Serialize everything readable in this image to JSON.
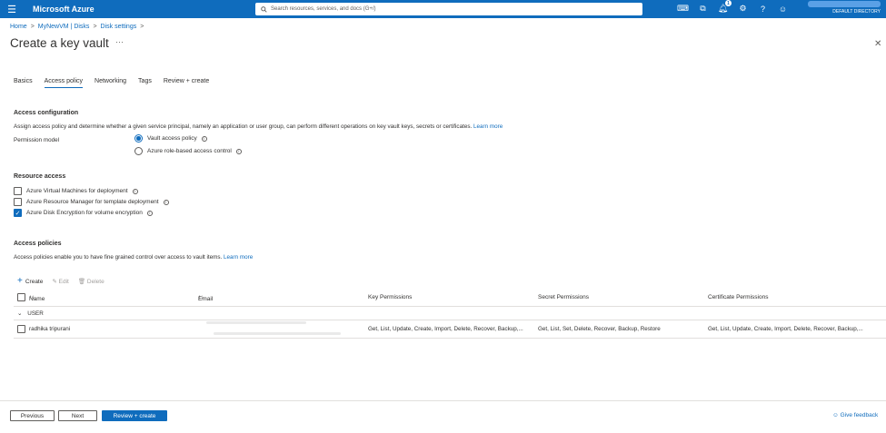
{
  "header": {
    "brand": "Microsoft Azure",
    "search_placeholder": "Search resources, services, and docs (G+/)",
    "notification_count": "1",
    "directory": "DEFAULT DIRECTORY"
  },
  "breadcrumb": [
    "Home",
    "MyNewVM | Disks",
    "Disk settings"
  ],
  "page": {
    "title": "Create a key vault",
    "more": "···",
    "close": "✕"
  },
  "tabs": [
    "Basics",
    "Access policy",
    "Networking",
    "Tags",
    "Review + create"
  ],
  "active_tab": "Access policy",
  "access_config": {
    "heading": "Access configuration",
    "description": "Assign access policy and determine whether a given service principal, namely an application or user group, can perform different operations on key vault keys, secrets or certificates.",
    "learn_more": "Learn more",
    "permission_label": "Permission model",
    "options": [
      "Vault access policy",
      "Azure role-based access control"
    ],
    "selected": "Vault access policy"
  },
  "resource_access": {
    "heading": "Resource access",
    "items": [
      {
        "label": "Azure Virtual Machines for deployment",
        "checked": false
      },
      {
        "label": "Azure Resource Manager for template deployment",
        "checked": false
      },
      {
        "label": "Azure Disk Encryption for volume encryption",
        "checked": true
      }
    ]
  },
  "access_policies": {
    "heading": "Access policies",
    "description": "Access policies enable you to have fine grained control over access to vault items.",
    "learn_more": "Learn more",
    "toolbar": {
      "create": "Create",
      "edit": "Edit",
      "delete": "Delete"
    },
    "columns": [
      "Name",
      "Email",
      "Key Permissions",
      "Secret Permissions",
      "Certificate Permissions"
    ],
    "group": "USER",
    "rows": [
      {
        "name": "radhika tripurani",
        "key": "Get, List, Update, Create, Import, Delete, Recover, Backup,...",
        "secret": "Get, List, Set, Delete, Recover, Backup, Restore",
        "cert": "Get, List, Update, Create, Import, Delete, Recover, Backup,..."
      }
    ]
  },
  "footer": {
    "previous": "Previous",
    "next": "Next",
    "review": "Review + create",
    "feedback": "Give feedback"
  }
}
